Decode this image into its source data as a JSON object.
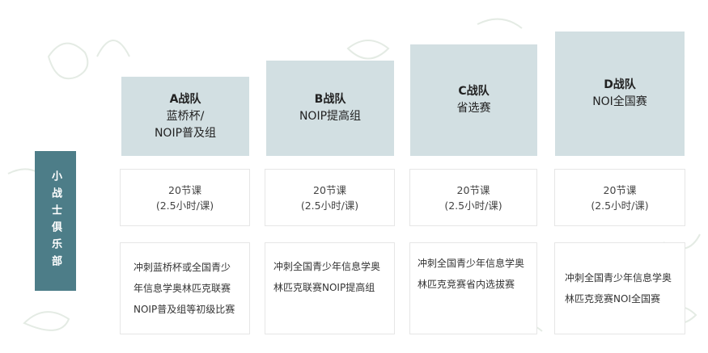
{
  "side_label": "小战士俱乐部",
  "teams": [
    {
      "name": "A战队",
      "level_lines": [
        "蓝桥杯/",
        "NOIP普及组"
      ],
      "hours_line1": "20节课",
      "hours_line2": "(2.5小时/课)",
      "desc_lines": [
        "冲刺蓝桥杯或全国青少",
        "年信息学奥林匹克联赛",
        "NOIP普及组等初级比赛"
      ]
    },
    {
      "name": "B战队",
      "level_lines": [
        "NOIP提高组"
      ],
      "hours_line1": "20节课",
      "hours_line2": "(2.5小时/课)",
      "desc_lines": [
        "冲刺全国青少年信息学奥",
        "林匹克联赛NOIP提高组"
      ]
    },
    {
      "name": "C战队",
      "level_lines": [
        "省选赛"
      ],
      "hours_line1": "20节课",
      "hours_line2": "(2.5小时/课)",
      "desc_lines": [
        "冲刺全国青少年信息学奥",
        "林匹克竞赛省内选拔赛"
      ]
    },
    {
      "name": "D战队",
      "level_lines": [
        "NOI全国赛"
      ],
      "hours_line1": "20节课",
      "hours_line2": "(2.5小时/课)",
      "desc_lines": [
        "冲刺全国青少年信息学奥",
        "林匹克竞赛NOI全国赛"
      ]
    }
  ],
  "colors": {
    "side_label_bg": "#4d7d88",
    "header_bg": "#d2dfe2",
    "card_border": "#e6e6e6",
    "decoration": "#e8ede8"
  }
}
